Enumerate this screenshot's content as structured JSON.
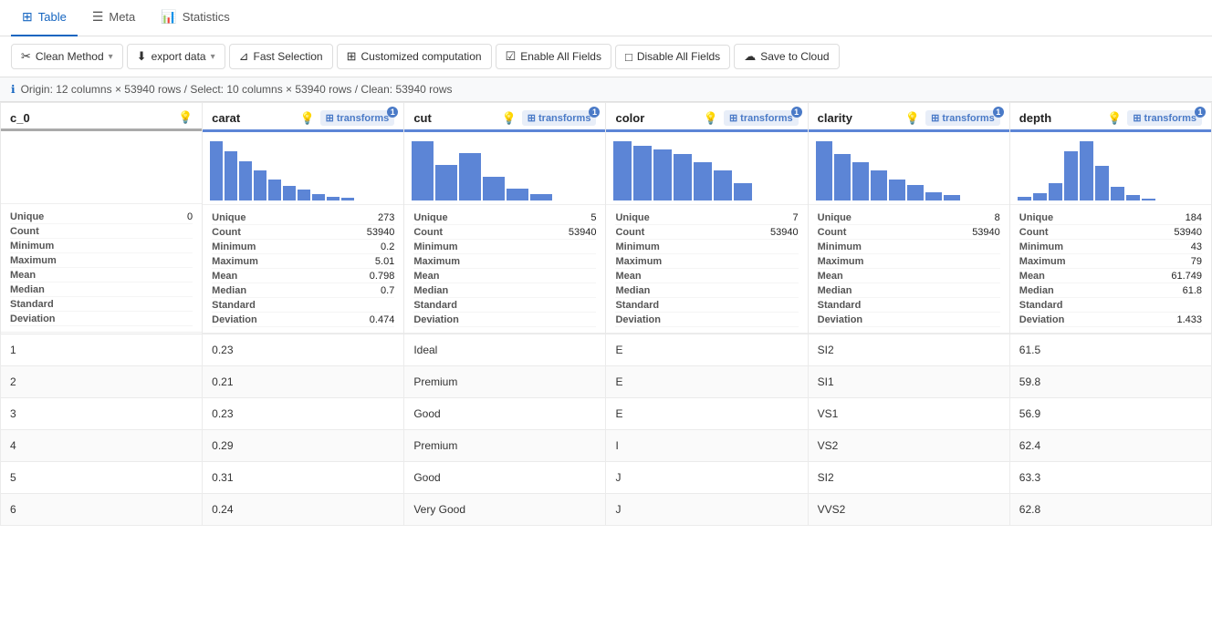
{
  "tabs": [
    {
      "id": "table",
      "label": "Table",
      "icon": "⊞",
      "active": true
    },
    {
      "id": "meta",
      "label": "Meta",
      "icon": "≡"
    },
    {
      "id": "statistics",
      "label": "Statistics",
      "icon": "📊"
    }
  ],
  "toolbar": {
    "clean_method": "Clean Method",
    "export_data": "export data",
    "fast_selection": "Fast Selection",
    "customized_computation": "Customized computation",
    "enable_all_fields": "Enable All Fields",
    "disable_all_fields": "Disable All Fields",
    "save_to_cloud": "Save to Cloud"
  },
  "info_bar": "Origin: 12 columns × 53940 rows / Select: 10 columns × 53940 rows / Clean: 53940 rows",
  "columns": [
    {
      "id": "c_0",
      "name": "c_0",
      "has_transforms": false,
      "stats": [
        {
          "label": "Unique",
          "value": "0"
        },
        {
          "label": "Count",
          "value": ""
        },
        {
          "label": "Minimum",
          "value": ""
        },
        {
          "label": "Maximum",
          "value": ""
        },
        {
          "label": "Mean",
          "value": ""
        },
        {
          "label": "Median",
          "value": ""
        },
        {
          "label": "Standard",
          "value": ""
        },
        {
          "label": "Deviation",
          "value": ""
        }
      ],
      "chart_bars": [],
      "rows": [
        "1",
        "2",
        "3",
        "4",
        "5",
        "6"
      ]
    },
    {
      "id": "carat",
      "name": "carat",
      "has_transforms": true,
      "stats": [
        {
          "label": "Unique",
          "value": "273"
        },
        {
          "label": "Count",
          "value": "53940"
        },
        {
          "label": "Minimum",
          "value": "0.2"
        },
        {
          "label": "Maximum",
          "value": "5.01"
        },
        {
          "label": "Mean",
          "value": "0.798"
        },
        {
          "label": "Median",
          "value": "0.7"
        },
        {
          "label": "Standard",
          "value": ""
        },
        {
          "label": "Deviation",
          "value": "0.474"
        }
      ],
      "chart_bars": [
        90,
        75,
        60,
        45,
        32,
        22,
        16,
        10,
        6,
        4
      ],
      "rows": [
        "0.23",
        "0.21",
        "0.23",
        "0.29",
        "0.31",
        "0.24"
      ]
    },
    {
      "id": "cut",
      "name": "cut",
      "has_transforms": true,
      "stats": [
        {
          "label": "Unique",
          "value": "5"
        },
        {
          "label": "Count",
          "value": "53940"
        },
        {
          "label": "Minimum",
          "value": ""
        },
        {
          "label": "Maximum",
          "value": ""
        },
        {
          "label": "Mean",
          "value": ""
        },
        {
          "label": "Median",
          "value": ""
        },
        {
          "label": "Standard",
          "value": ""
        },
        {
          "label": "Deviation",
          "value": ""
        }
      ],
      "chart_bars": [
        75,
        45,
        60,
        30,
        15,
        8
      ],
      "rows": [
        "Ideal",
        "Premium",
        "Good",
        "Premium",
        "Good",
        "Very Good"
      ]
    },
    {
      "id": "color",
      "name": "color",
      "has_transforms": true,
      "stats": [
        {
          "label": "Unique",
          "value": "7"
        },
        {
          "label": "Count",
          "value": "53940"
        },
        {
          "label": "Minimum",
          "value": ""
        },
        {
          "label": "Maximum",
          "value": ""
        },
        {
          "label": "Mean",
          "value": ""
        },
        {
          "label": "Median",
          "value": ""
        },
        {
          "label": "Standard",
          "value": ""
        },
        {
          "label": "Deviation",
          "value": ""
        }
      ],
      "chart_bars": [
        70,
        65,
        60,
        55,
        45,
        35,
        20
      ],
      "rows": [
        "E",
        "E",
        "E",
        "I",
        "J",
        "J"
      ]
    },
    {
      "id": "clarity",
      "name": "clarity",
      "has_transforms": true,
      "stats": [
        {
          "label": "Unique",
          "value": "8"
        },
        {
          "label": "Count",
          "value": "53940"
        },
        {
          "label": "Minimum",
          "value": ""
        },
        {
          "label": "Maximum",
          "value": ""
        },
        {
          "label": "Mean",
          "value": ""
        },
        {
          "label": "Median",
          "value": ""
        },
        {
          "label": "Standard",
          "value": ""
        },
        {
          "label": "Deviation",
          "value": ""
        }
      ],
      "chart_bars": [
        70,
        55,
        45,
        35,
        25,
        18,
        10,
        6
      ],
      "rows": [
        "SI2",
        "SI1",
        "VS1",
        "VS2",
        "SI2",
        "VVS2"
      ]
    },
    {
      "id": "depth",
      "name": "depth",
      "has_transforms": true,
      "stats": [
        {
          "label": "Unique",
          "value": "184"
        },
        {
          "label": "Count",
          "value": "53940"
        },
        {
          "label": "Minimum",
          "value": "43"
        },
        {
          "label": "Maximum",
          "value": "79"
        },
        {
          "label": "Mean",
          "value": "61.749"
        },
        {
          "label": "Median",
          "value": "61.8"
        },
        {
          "label": "Standard",
          "value": ""
        },
        {
          "label": "Deviation",
          "value": "1.433"
        }
      ],
      "chart_bars": [
        5,
        10,
        25,
        70,
        85,
        50,
        20,
        8,
        3
      ],
      "rows": [
        "61.5",
        "59.8",
        "56.9",
        "62.4",
        "63.3",
        "62.8"
      ]
    }
  ],
  "icons": {
    "table": "⊞",
    "meta": "⋮≡",
    "statistics": "📊",
    "clean": "✂",
    "export": "⬇",
    "filter": "⊿",
    "grid": "⊞",
    "checkbox": "☑",
    "square": "□",
    "cloud": "☁",
    "info": "ℹ",
    "bulb": "💡",
    "caret_down": "▾"
  }
}
